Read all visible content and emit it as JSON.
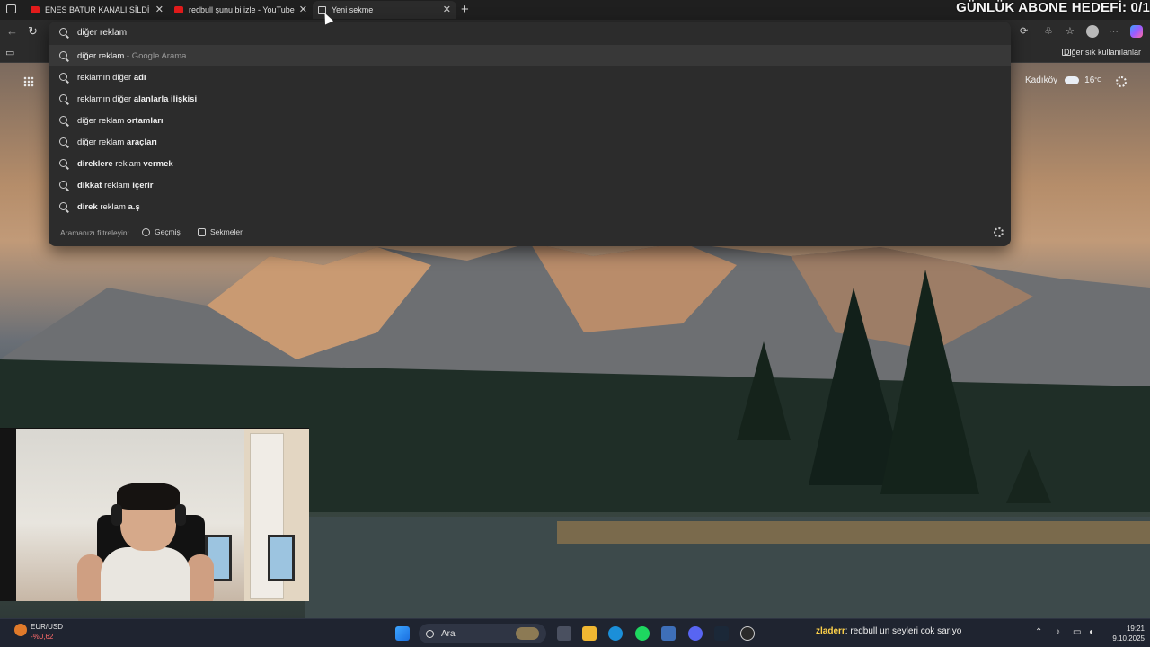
{
  "stream_overlay": {
    "goal_text": "GÜNLÜK ABONE HEDEFİ: 0/1"
  },
  "tabs": [
    {
      "title": "ENES BATUR KANALI SİLDİ AQ - Y",
      "favicon": "youtube-icon",
      "active": false
    },
    {
      "title": "redbull şunu bi izle - YouTube",
      "favicon": "youtube-icon",
      "active": false
    },
    {
      "title": "Yeni sekme",
      "favicon": "new-tab-icon",
      "active": true
    }
  ],
  "omnibox": {
    "query": "diğer reklam",
    "suggestions": [
      {
        "parts": [
          [
            "diğer reklam",
            false
          ]
        ],
        "source": " - Google Arama"
      },
      {
        "parts": [
          [
            "reklamın diğer ",
            false
          ],
          [
            "adı",
            true
          ]
        ],
        "source": ""
      },
      {
        "parts": [
          [
            "reklamın diğer ",
            false
          ],
          [
            "alanlarla ilişkisi",
            true
          ]
        ],
        "source": ""
      },
      {
        "parts": [
          [
            "diğer reklam ",
            false
          ],
          [
            "ortamları",
            true
          ]
        ],
        "source": ""
      },
      {
        "parts": [
          [
            "diğer reklam ",
            false
          ],
          [
            "araçları",
            true
          ]
        ],
        "source": ""
      },
      {
        "parts": [
          [
            "direklere",
            true
          ],
          [
            " reklam ",
            false
          ],
          [
            "vermek",
            true
          ]
        ],
        "source": ""
      },
      {
        "parts": [
          [
            "dikkat",
            true
          ],
          [
            " reklam ",
            false
          ],
          [
            "içerir",
            true
          ]
        ],
        "source": ""
      },
      {
        "parts": [
          [
            "direk",
            true
          ],
          [
            " reklam ",
            false
          ],
          [
            "a.ş",
            true
          ]
        ],
        "source": ""
      }
    ],
    "filter_label": "Aramanızı filtreleyin:",
    "filter_history": "Geçmiş",
    "filter_tabs": "Sekmeler"
  },
  "favorites_bar": {
    "other_favorites": "Diğer sık kullanılanlar"
  },
  "weather": {
    "location": "Kadıköy",
    "temperature": "16",
    "unit": "°C"
  },
  "taskbar": {
    "search_placeholder": "Ara",
    "fx_pair": "EUR/USD",
    "fx_change": "-%0,62",
    "chat_user": "zladerr",
    "chat_message": ": redbull un seyleri cok sarıyo",
    "time": "19:21",
    "date": "9.10.2025"
  },
  "colors": {
    "youtube": "#e21b1b",
    "fx_negative": "#ff6b6b",
    "chat_user": "#ffd24a"
  }
}
